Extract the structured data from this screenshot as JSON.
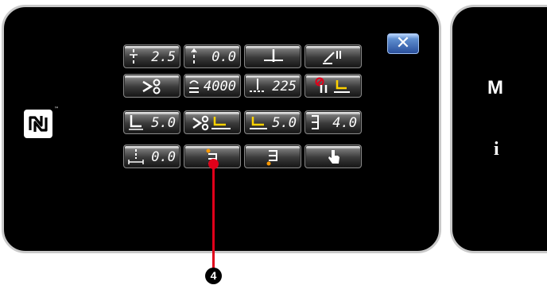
{
  "buttons": {
    "r1c1": "2.5",
    "r1c2": "0.0",
    "r2c2": "4000",
    "r2c3": "225",
    "r3c1": "5.0",
    "r3c3": "5.0",
    "r3c4": "4.0",
    "r4c1": "0.0"
  },
  "close_label": "✕",
  "side": {
    "m_label": "M",
    "info_label": "i"
  },
  "callout": {
    "number": "4"
  },
  "colors": {
    "accent_red": "#e0001a",
    "close_blue": "#2a4f9c",
    "dot_orange": "#ff9a00"
  }
}
